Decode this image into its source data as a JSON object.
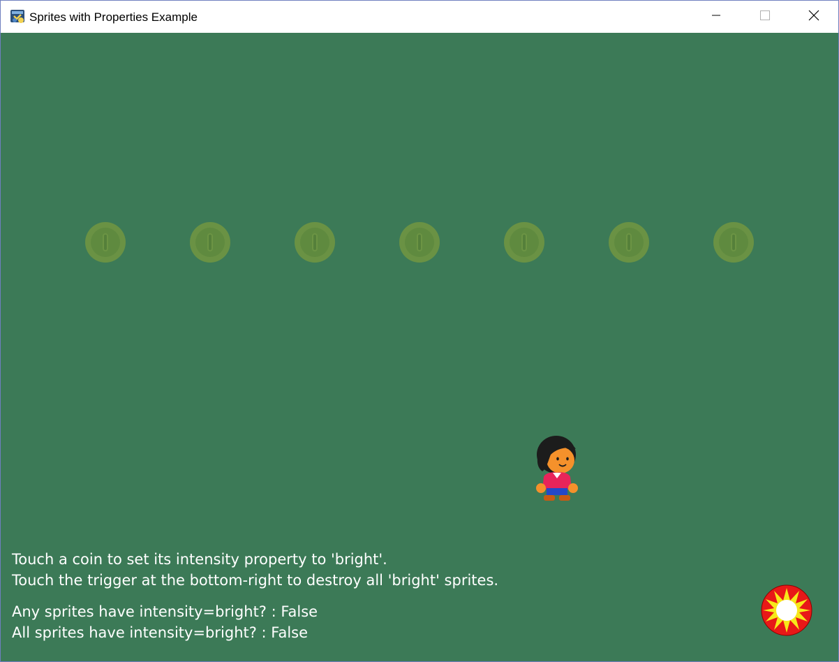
{
  "window": {
    "title": "Sprites with Properties Example",
    "icon": "python-app-icon",
    "controls": {
      "minimize": "minimize-icon",
      "maximize": "maximize-icon",
      "close": "close-icon"
    }
  },
  "game": {
    "background_color": "#3c7a57",
    "coins": [
      {
        "id": "coin-1",
        "intensity": "dim"
      },
      {
        "id": "coin-2",
        "intensity": "dim"
      },
      {
        "id": "coin-3",
        "intensity": "dim"
      },
      {
        "id": "coin-4",
        "intensity": "dim"
      },
      {
        "id": "coin-5",
        "intensity": "dim"
      },
      {
        "id": "coin-6",
        "intensity": "dim"
      },
      {
        "id": "coin-7",
        "intensity": "dim"
      }
    ],
    "coin_color": "#6c9444",
    "player": "player-character",
    "trigger": "trigger-sun-icon",
    "instructions": {
      "line1": "Touch a coin to set its intensity property to 'bright'.",
      "line2": "Touch the trigger at the bottom-right to destroy all 'bright' sprites."
    },
    "status": {
      "any_line": "Any sprites have intensity=bright? : False",
      "all_line": "All sprites have intensity=bright? : False"
    }
  }
}
